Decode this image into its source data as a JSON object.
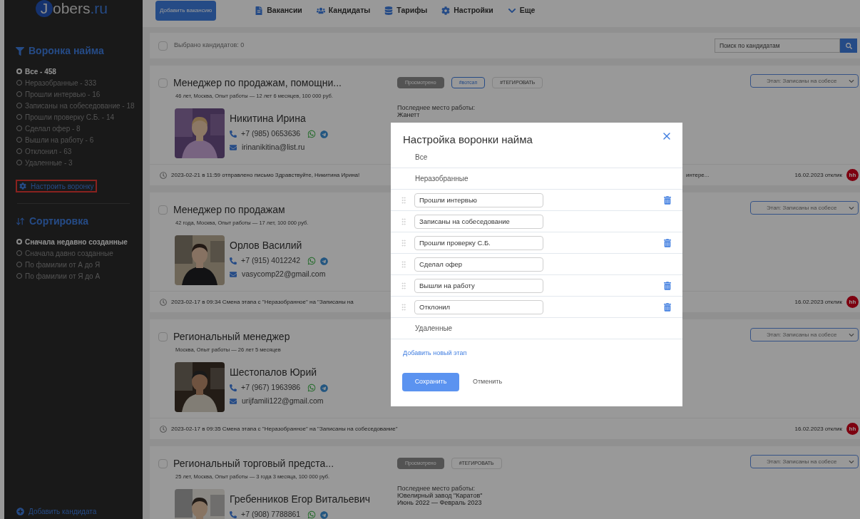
{
  "sidebar": {
    "logo": {
      "mark": "J",
      "name": "obers",
      "tld": ".ru"
    },
    "funnel": {
      "title": "Воронка найма",
      "items": [
        {
          "label": "Все - 458",
          "selected": true
        },
        {
          "label": "Неразобранные - 333",
          "selected": false
        },
        {
          "label": "Прошли интервью - 16",
          "selected": false
        },
        {
          "label": "Записаны на собеседование - 18",
          "selected": false
        },
        {
          "label": "Прошли проверку С.Б. - 14",
          "selected": false
        },
        {
          "label": "Сделал офер - 8",
          "selected": false
        },
        {
          "label": "Вышли на работу - 6",
          "selected": false
        },
        {
          "label": "Отклонил - 63",
          "selected": false
        },
        {
          "label": "Удаленные - 3",
          "selected": false
        }
      ],
      "configure_link": "Настроить воронку",
      "configure_highlighted": true
    },
    "sorting": {
      "title": "Сортировка",
      "items": [
        {
          "label": "Сначала недавно созданные",
          "selected": true
        },
        {
          "label": "Сначала давно созданные",
          "selected": false
        },
        {
          "label": "По фамилии от А до Я",
          "selected": false
        },
        {
          "label": "По фамилии от Я до А",
          "selected": false
        }
      ]
    },
    "add_candidate": "Добавить кандидата"
  },
  "topbar": {
    "add_button": "Добавить вакансию",
    "nav": [
      {
        "label": "Вакансии",
        "kind": "vacancies"
      },
      {
        "label": "Кандидаты",
        "kind": "candidates"
      },
      {
        "label": "Тарифы",
        "kind": "tariffs"
      },
      {
        "label": "Настройки",
        "kind": "settings"
      },
      {
        "label": "Еще",
        "kind": "more"
      }
    ]
  },
  "selection_bar": {
    "checked": false,
    "label": "Выбрано кандидатов: 0",
    "search": {
      "placeholder": "Поиск по кандидатам"
    }
  },
  "candidates": [
    {
      "checked": false,
      "title": "Менеджер по продажам, помощни...",
      "details": "46 лет, Москва, Опыт работы — 12 лет 6 месяцев, 100 000 руб.",
      "name": "Никитина Ирина",
      "phone": "+7 (985) 0653636",
      "email": "irinanikitina@list.ru",
      "tags": [
        {
          "label": "Просмотрено",
          "kind": "viewed"
        },
        {
          "label": "#вотсап",
          "kind": "tag"
        },
        {
          "label": "#ТЕГИРОВАТЬ",
          "kind": "add"
        }
      ],
      "last_job": {
        "label": "Последнее место работы:",
        "lines": [
          "Жанетт"
        ]
      },
      "stage": "Этап: Записаны на собесе",
      "activity": "2023-02-21 в 11:59 отправлено письмо Здравствуйте, Никитина Ирина!",
      "activity_tail": "интере...",
      "response_date": "16.02.2023 отклик",
      "source": "hh"
    },
    {
      "checked": false,
      "title": "Менеджер по продажам",
      "details": "42 года, Москва, Опыт работы — 17 лет, 100 000 руб.",
      "name": "Орлов Василий",
      "phone": "+7 (915) 4012242",
      "email": "vasycomp22@gmail.com",
      "stage": "Этап: Записаны на собесе",
      "activity": "2023-02-17 в 09:34 Смена этапа с \"Неразобранное\" на \"Записаны на",
      "response_date": "16.02.2023 отклик",
      "source": "hh"
    },
    {
      "checked": false,
      "title": "Региональный менеджер",
      "details": "Москва, Опыт работы — 26 лет 5 месяцев",
      "name": "Шестопалов Юрий",
      "phone": "+7 (967) 1963986",
      "email": "urijfamili122@gmail.com",
      "stage": "Этап: Записаны на собесе",
      "activity": "2023-02-17 в 09:35 Смена этапа с \"Неразобранное\" на \"Записаны на собеседование\"",
      "response_date": "16.02.2023 отклик",
      "source": "hh"
    },
    {
      "checked": false,
      "title": "Региональный торговый предста...",
      "details": "25 лет, Москва, Опыт работы — 3 года 3 месяца, 100 000 руб.",
      "name": "Гребенников Егор Витальевич",
      "phone": "+7 (908) 7788861",
      "tags": [
        {
          "label": "Просмотрено",
          "kind": "viewed"
        },
        {
          "label": "#ТЕГИРОВАТЬ",
          "kind": "add"
        }
      ],
      "last_job": {
        "label": "Последнее место работы:",
        "lines": [
          "Ювелирный завод \"Каратов\"",
          "Июнь 2022 — Февраль 2023"
        ]
      },
      "stage": "Этап: Записаны на собесе"
    }
  ],
  "dialog": {
    "title": "Настройка воронки найма",
    "stages": [
      {
        "kind": "fixed",
        "label": "Все"
      },
      {
        "kind": "fixed",
        "label": "Неразобранные"
      },
      {
        "kind": "editable",
        "value": "Прошли интервью",
        "deletable": true
      },
      {
        "kind": "editable",
        "value": "Записаны на собеседование",
        "deletable": false
      },
      {
        "kind": "editable",
        "value": "Прошли проверку С.Б.",
        "deletable": true
      },
      {
        "kind": "editable",
        "value": "Сделал офер",
        "deletable": false
      },
      {
        "kind": "editable",
        "value": "Вышли на работу",
        "deletable": true
      },
      {
        "kind": "editable",
        "value": "Отклонил",
        "deletable": true
      },
      {
        "kind": "fixed",
        "label": "Удаленные"
      }
    ],
    "add_stage": "Добавить новый этап",
    "save": "Сохранить",
    "cancel": "Отменить"
  }
}
